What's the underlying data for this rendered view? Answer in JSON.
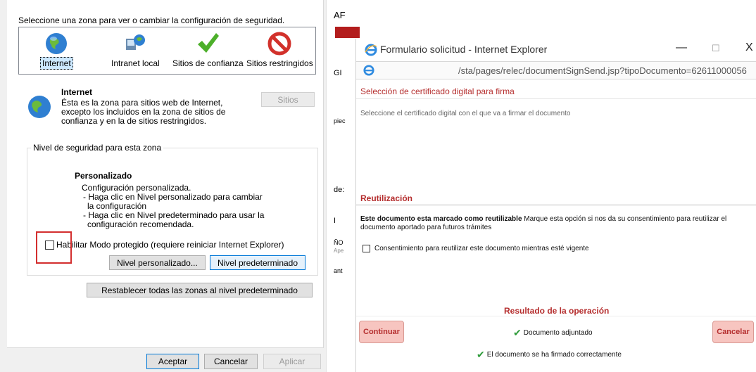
{
  "security_dialog": {
    "prompt": "Seleccione una zona para ver o cambiar la configuración de seguridad.",
    "zones": [
      {
        "label": "Internet",
        "icon": "globe-icon",
        "selected": true
      },
      {
        "label": "Intranet local",
        "icon": "intranet-icon",
        "selected": false
      },
      {
        "label": "Sitios de confianza",
        "icon": "check-icon",
        "selected": false
      },
      {
        "label": "Sitios restringidos",
        "icon": "no-entry-icon",
        "selected": false
      }
    ],
    "zone_name": "Internet",
    "zone_description": "Ésta es la zona para sitios web de Internet, excepto los incluidos en la zona de sitios de confianza y en la de sitios restringidos.",
    "sites_button": "Sitios",
    "level_legend": "Nivel de seguridad para esta zona",
    "custom_title": "Personalizado",
    "custom_lines": [
      "Configuración personalizada.",
      "- Haga clic en Nivel personalizado para cambiar",
      "  la configuración",
      "- Haga clic en Nivel predeterminado para usar la",
      "  configuración recomendada."
    ],
    "protected_mode_label": "Habilitar Modo protegido (requiere reiniciar Internet Explorer)",
    "protected_mode_checked": false,
    "custom_level_button": "Nivel personalizado...",
    "default_level_button": "Nivel predeterminado",
    "reset_all_button": "Restablecer todas las zonas al nivel predeterminado",
    "accept_button": "Aceptar",
    "cancel_button": "Cancelar",
    "apply_button": "Aplicar"
  },
  "background_strip": {
    "texts": [
      "AF",
      "GI",
      "piec",
      "de:",
      "I",
      "ÑO",
      "Ape",
      "ant"
    ]
  },
  "ie_window": {
    "title": "Formulario solicitud - Internet Explorer",
    "url": "/sta/pages/relec/documentSignSend.jsp?tipoDocumento=62611000056",
    "cert_section_title": "Selección de certificado digital para firma",
    "cert_instruction": "Seleccione el certificado digital con el que va a firmar el documento",
    "reuse_section_title": "Reutilización",
    "reuse_bold": "Este documento esta marcado como reutilizable",
    "reuse_text": " Marque esta opción si nos da su consentimiento para reutilizar el documento aportado para futuros trámites",
    "consent_label": "Consentimiento para reutilizar este documento mientras esté vigente",
    "consent_checked": false,
    "result_title": "Resultado de la operación",
    "continue_button": "Continuar",
    "cancel_button": "Cancelar",
    "status_attached": "Documento adjuntado",
    "status_signed": "El documento se ha firmado correctamente",
    "window_controls": {
      "minimize": "—",
      "maximize": "☐",
      "close": "X"
    },
    "accent_color": "#b52e2e"
  }
}
